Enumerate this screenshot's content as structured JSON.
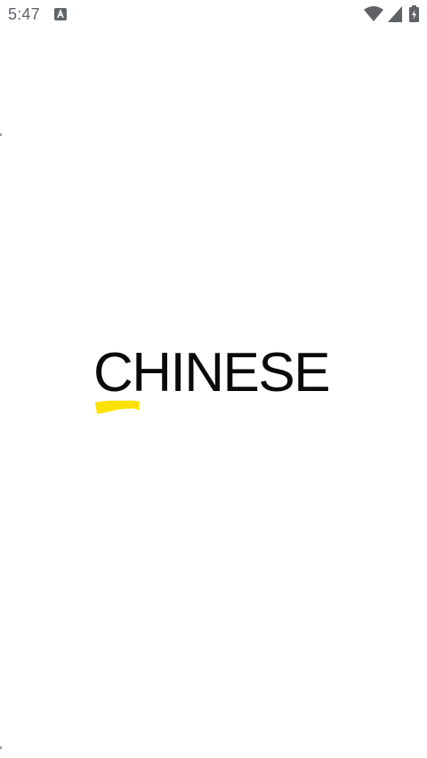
{
  "status_bar": {
    "time": "5:47",
    "notification_icon": "text-a-notification-icon",
    "wifi_icon": "wifi-icon",
    "signal_icon": "cell-signal-icon",
    "battery_icon": "battery-charging-icon",
    "icon_color": "#5f6368"
  },
  "splash": {
    "logo_text": "CHINESE",
    "accent_color": "#ffe100",
    "text_color": "#0a0a0a",
    "background": "#ffffff"
  }
}
